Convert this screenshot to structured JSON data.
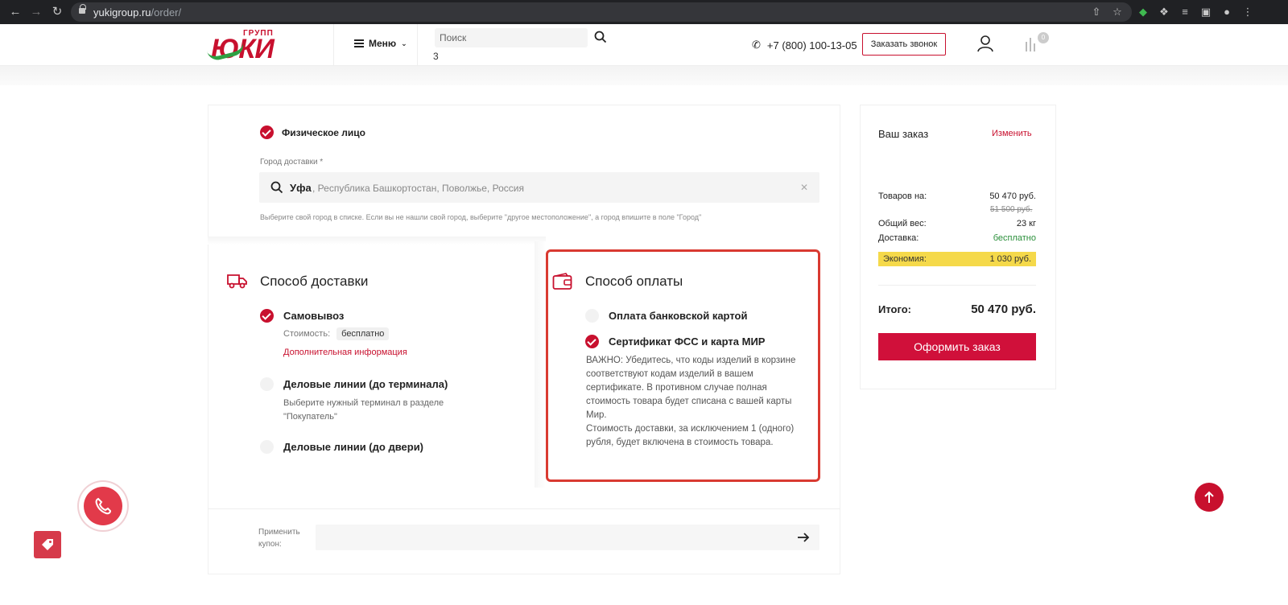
{
  "browser": {
    "url_host": "yukigroup.ru",
    "url_path": "/order/"
  },
  "header": {
    "logo_top": "ГРУПП",
    "logo_main": "ЮКИ",
    "menu_label": "Меню",
    "search_placeholder": "Поиск",
    "search_extra": "3",
    "phone": "+7 (800) 100-13-05",
    "callback_label": "Заказать звонок",
    "cart_count": "0"
  },
  "buyer": {
    "type_label": "Физическое лицо",
    "city_label": "Город доставки *",
    "city_bold": "Уфа",
    "city_rest": ", Республика Башкортостан, Поволжье, Россия",
    "city_hint": "Выберите свой город в списке. Если вы не нашли свой город, выберите \"другое местоположение\", а город впишите в поле \"Город\""
  },
  "delivery": {
    "title": "Способ доставки",
    "options": [
      {
        "label": "Самовывоз",
        "selected": true
      },
      {
        "label": "Деловые линии (до терминала)",
        "selected": false
      },
      {
        "label": "Деловые линии (до двери)",
        "selected": false
      }
    ],
    "cost_label": "Стоимость:",
    "cost_value": "бесплатно",
    "more_info": "Дополнительная информация",
    "terminal_desc_1": "Выберите нужный терминал в разделе",
    "terminal_desc_2": "\"Покупатель\""
  },
  "payment": {
    "title": "Способ оплаты",
    "options": [
      {
        "label": "Оплата банковской картой",
        "selected": false
      },
      {
        "label": "Сертификат ФСС и карта МИР",
        "selected": true
      }
    ],
    "note_1": "ВАЖНО: Убедитесь, что коды изделий в корзине соответствуют кодам изделий в вашем сертификате. В противном случае полная стоимость товара будет списана с вашей карты Мир.",
    "note_2": "Стоимость доставки, за исключением 1 (одного) рубля, будет включена в стоимость товара."
  },
  "coupon": {
    "label": "Применить купон:"
  },
  "summary": {
    "title": "Ваш заказ",
    "edit": "Изменить",
    "goods_label": "Товаров на:",
    "goods_value": "50 470 руб.",
    "goods_old": "51 500 руб.",
    "weight_label": "Общий вес:",
    "weight_value": "23 кг",
    "delivery_label": "Доставка:",
    "delivery_value": "бесплатно",
    "economy_label": "Экономия:",
    "economy_value": "1 030 руб.",
    "total_label": "Итого:",
    "total_value": "50 470 руб.",
    "order_button": "Оформить заказ"
  },
  "colors": {
    "brand": "#c8102e",
    "highlight": "#d93a31",
    "economy_bg": "#f5d94a",
    "free_text": "#2a8f3a"
  }
}
